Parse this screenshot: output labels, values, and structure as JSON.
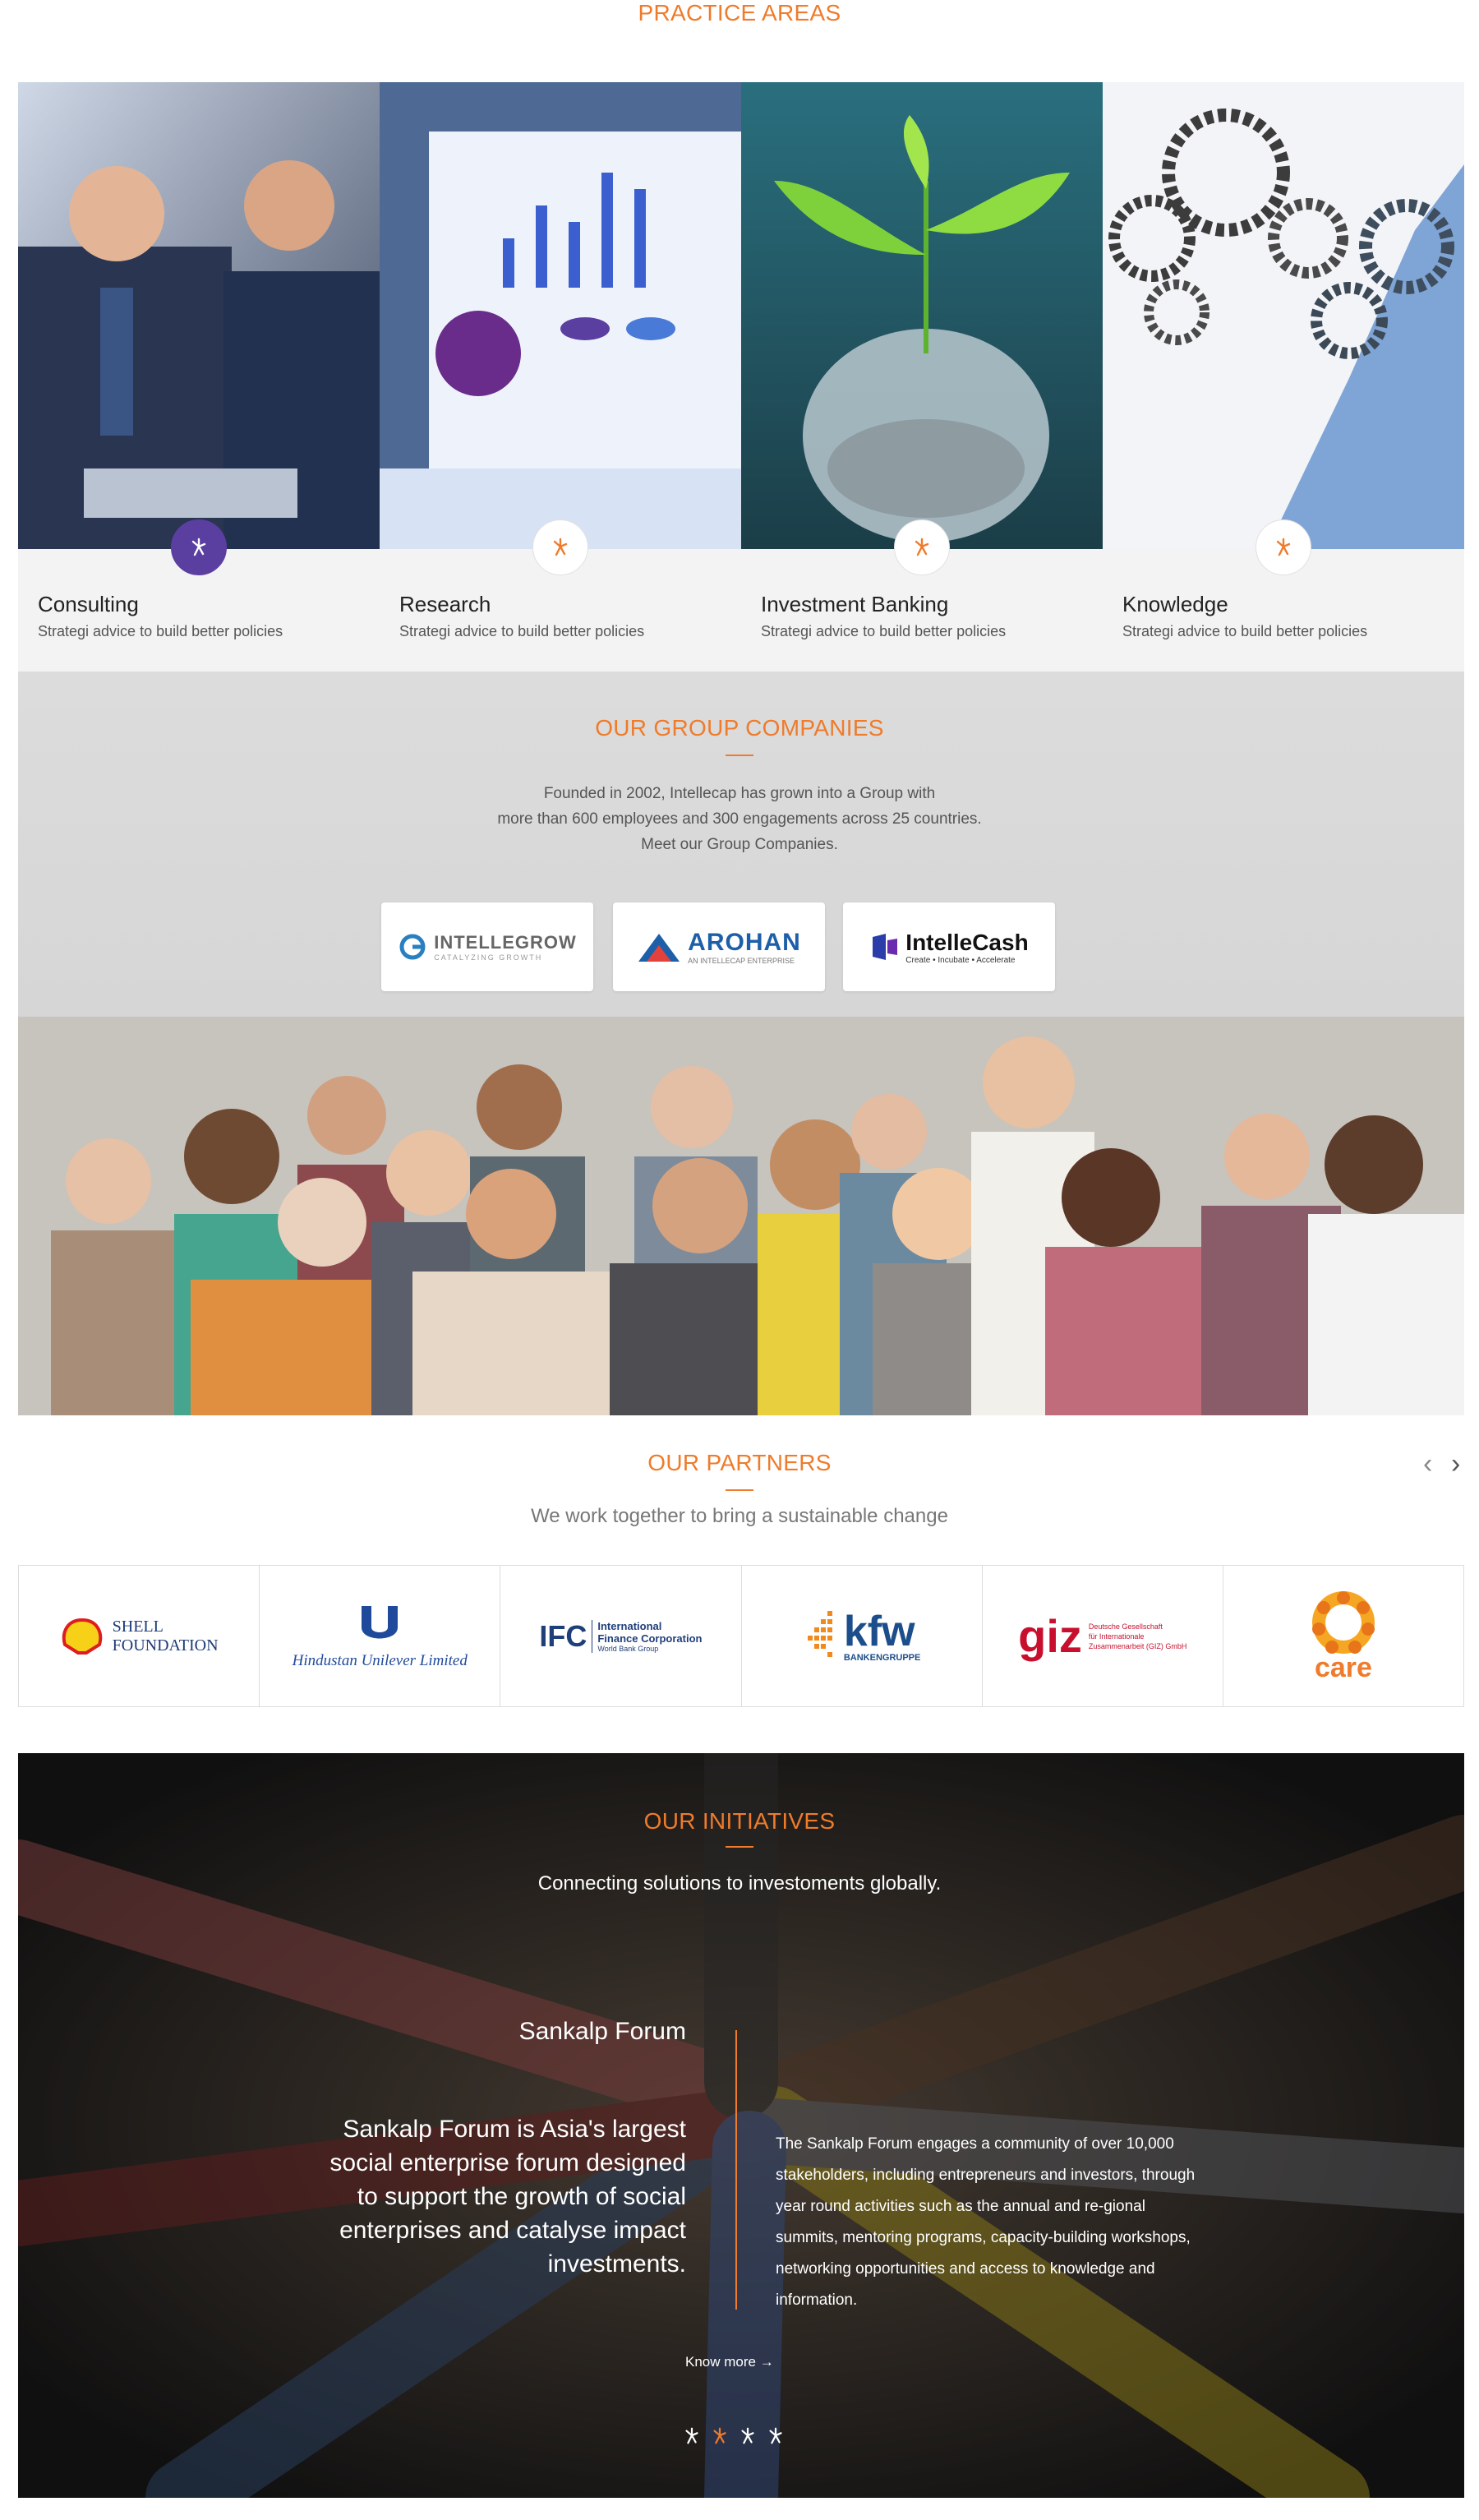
{
  "practice": {
    "title": "PRACTICE AREAS",
    "cards": [
      {
        "label": "Consulting",
        "sub": "Strategi advice to build better policies",
        "active": true
      },
      {
        "label": "Research",
        "sub": "Strategi advice to build better policies",
        "active": false
      },
      {
        "label": "Investment Banking",
        "sub": "Strategi advice to build better policies",
        "active": false
      },
      {
        "label": "Knowledge",
        "sub": "Strategi advice to build better policies",
        "active": false
      }
    ]
  },
  "group": {
    "title": "OUR GROUP COMPANIES",
    "desc_line1": "Founded in 2002, Intellecap has grown into a Group with",
    "desc_line2": "more than 600 employees and 300 engagements across 25 countries.",
    "desc_line3": "Meet our Group Companies.",
    "logos": [
      {
        "name": "INTELLEGROW",
        "tagline": "CATALYZING GROWTH"
      },
      {
        "name": "AROHAN",
        "tagline": "AN INTELLECAP ENTERPRISE"
      },
      {
        "name": "IntelleCash",
        "tagline": "Create • Incubate • Accelerate"
      }
    ]
  },
  "partners": {
    "title": "OUR PARTNERS",
    "tagline": "We work together to bring a sustainable change",
    "prev": "‹",
    "next": "›",
    "logos": {
      "shell_line1": "SHELL",
      "shell_line2": "FOUNDATION",
      "hul": "Hindustan Unilever Limited",
      "ifc_mark": "IFC",
      "ifc_line1": "International",
      "ifc_line2": "Finance Corporation",
      "ifc_line3": "World Bank Group",
      "kfw": "kfw",
      "kfw_sub": "BANKENGRUPPE",
      "giz": "giz",
      "giz_line1": "Deutsche Gesellschaft",
      "giz_line2": "für Internationale",
      "giz_line3": "Zusammenarbeit (GIZ) GmbH",
      "care": "care"
    }
  },
  "initiatives": {
    "title": "OUR INITIATIVES",
    "tagline": "Connecting solutions to investoments globally.",
    "forum_name": "Sankalp Forum",
    "forum_lead": "Sankalp Forum is Asia's largest social enterprise forum designed to support the growth of social enterprises and catalyse impact investments.",
    "forum_body": "The Sankalp Forum engages a community of over 10,000 stakeholders, including entrepreneurs and investors, through year round activities such as the annual and re-gional summits, mentoring programs, capacity-building workshops, networking opportunities and access to knowledge and information.",
    "know_more": "Know more →"
  },
  "colors": {
    "accent": "#ef7b2b",
    "purple": "#5b3fa0"
  }
}
